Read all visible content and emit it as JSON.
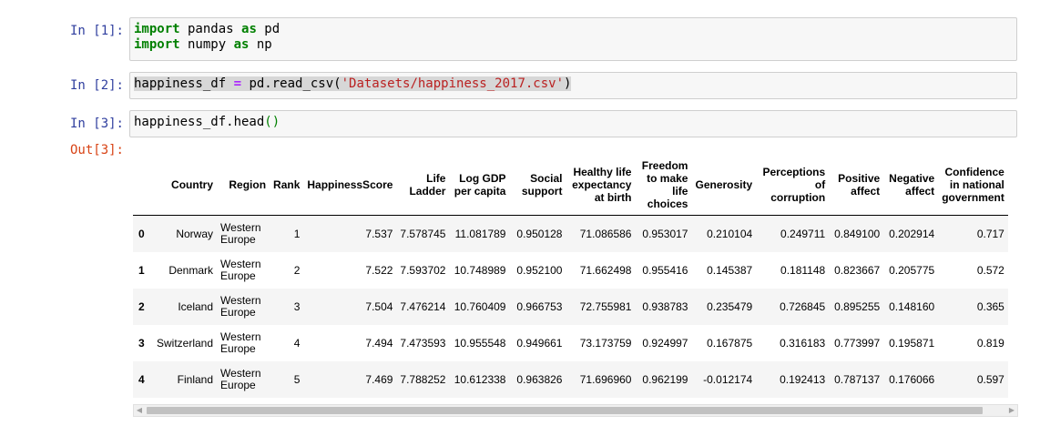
{
  "cells": [
    {
      "prompt": "In [1]:",
      "line1": {
        "kw1": "import",
        "mod1": " pandas ",
        "kw2": "as",
        "alias": " pd"
      },
      "line2": {
        "kw1": "import",
        "mod1": " numpy ",
        "kw2": "as",
        "alias": " np"
      }
    },
    {
      "prompt": "In [2]:",
      "var": "happiness_df ",
      "op": "=",
      "call": " pd.read_csv(",
      "str": "'Datasets/happiness_2017.csv'",
      "close": ")"
    },
    {
      "prompt": "In [3]:",
      "code": "happiness_df.head",
      "paren": "()"
    }
  ],
  "output": {
    "prompt": "Out[3]:",
    "columns": [
      "",
      "Country",
      "Region",
      "Rank",
      "HappinessScore",
      "Life Ladder",
      "Log GDP per capita",
      "Social support",
      "Healthy life expectancy at birth",
      "Freedom to make life choices",
      "Generosity",
      "Perceptions of corruption",
      "Positive affect",
      "Negative affect",
      "Confidence in national government"
    ],
    "rows": [
      [
        "0",
        "Norway",
        "Western Europe",
        "1",
        "7.537",
        "7.578745",
        "11.081789",
        "0.950128",
        "71.086586",
        "0.953017",
        "0.210104",
        "0.249711",
        "0.849100",
        "0.202914",
        "0.717"
      ],
      [
        "1",
        "Denmark",
        "Western Europe",
        "2",
        "7.522",
        "7.593702",
        "10.748989",
        "0.952100",
        "71.662498",
        "0.955416",
        "0.145387",
        "0.181148",
        "0.823667",
        "0.205775",
        "0.572"
      ],
      [
        "2",
        "Iceland",
        "Western Europe",
        "3",
        "7.504",
        "7.476214",
        "10.760409",
        "0.966753",
        "72.755981",
        "0.938783",
        "0.235479",
        "0.726845",
        "0.895255",
        "0.148160",
        "0.365"
      ],
      [
        "3",
        "Switzerland",
        "Western Europe",
        "4",
        "7.494",
        "7.473593",
        "10.955548",
        "0.949661",
        "73.173759",
        "0.924997",
        "0.167875",
        "0.316183",
        "0.773997",
        "0.195871",
        "0.819"
      ],
      [
        "4",
        "Finland",
        "Western Europe",
        "5",
        "7.469",
        "7.788252",
        "10.612338",
        "0.963826",
        "71.696960",
        "0.962199",
        "-0.012174",
        "0.192413",
        "0.787137",
        "0.176066",
        "0.597"
      ]
    ]
  },
  "scrollbar": {
    "left_arrow": "◀",
    "right_arrow": "▶"
  }
}
